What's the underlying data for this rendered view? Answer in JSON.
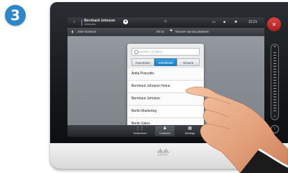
{
  "step_badge": "3",
  "status_bar": {
    "caller_name": "Bernhard Johnson",
    "caller_status": "Verbonden",
    "time": "12:21"
  },
  "sub_bar": {
    "participant": "Jane Dowson",
    "duration": "00:21",
    "new_call_label": "Nieuwe oproep plaatsen"
  },
  "dialog": {
    "search_placeholder": "Zoeken of bellen",
    "tabs": [
      {
        "label": "Favorieten",
        "active": false
      },
      {
        "label": "Adresboek",
        "active": true
      },
      {
        "label": "Historie",
        "active": false
      }
    ],
    "contacts": [
      "Anita Poscotto",
      "Bernhard Johnson Home",
      "Bernhard Johnson",
      "Berlin Marketing",
      "Berlin Sales"
    ]
  },
  "bottom_bar": {
    "buttons": [
      {
        "label": "Toetsenbord",
        "icon": "keypad-icon",
        "active": false
      },
      {
        "label": "Contacten",
        "icon": "contacts-icon",
        "active": true
      },
      {
        "label": "Meetings",
        "icon": "meetings-icon",
        "active": false
      }
    ]
  },
  "brand": {
    "logo_text": "cisco"
  },
  "colors": {
    "accent": "#1c7fc4",
    "badge": "#2f86c9",
    "call_active": "#3cc84b",
    "mute": "#c62828"
  }
}
